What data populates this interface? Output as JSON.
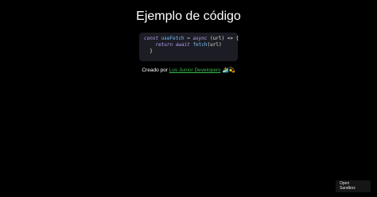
{
  "page": {
    "title": "Ejemplo de código"
  },
  "code": {
    "line1": {
      "const": "const",
      "name": "useFetch",
      "eq": " = ",
      "async": "async",
      "rest": " (url) => {"
    },
    "line2": {
      "indent": "    ",
      "return": "return",
      "space": " ",
      "await": "await",
      "fetch": " fetch",
      "args": "(url)"
    },
    "line3": {
      "text": "  }"
    }
  },
  "credit": {
    "prefix": "Creado por ",
    "link_text": "Los Junior Developers",
    "emoji": " 🏄💫"
  },
  "sandbox_button": {
    "line1": "Open",
    "line2": "Sandbox"
  },
  "colors": {
    "background": "#000000",
    "code_bg": "#1c1c24",
    "link": "#3fb950"
  }
}
